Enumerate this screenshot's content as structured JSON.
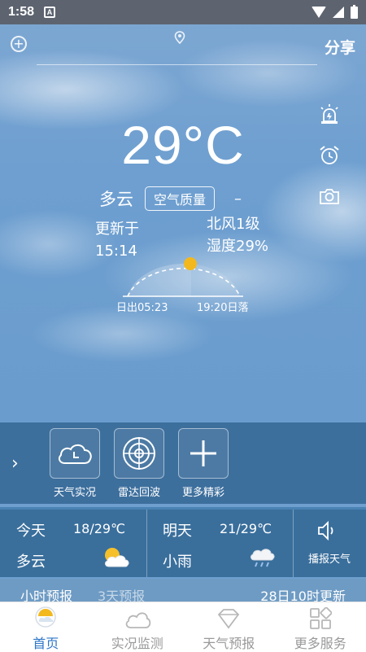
{
  "status_bar": {
    "time": "1:58",
    "badge": "A"
  },
  "header": {
    "share_label": "分享"
  },
  "current": {
    "temperature": "29°C",
    "condition": "多云",
    "aqi_label": "空气质量",
    "aqi_value": "–",
    "update_label": "更新于",
    "update_time": "15:14",
    "wind": "北风1级",
    "humidity": "湿度29%",
    "sunrise": "日出05:23",
    "sunset": "19:20日落"
  },
  "tools": [
    {
      "label": "天气实况",
      "icon": "cloud-clock-icon"
    },
    {
      "label": "雷达回波",
      "icon": "radar-icon"
    },
    {
      "label": "更多精彩",
      "icon": "plus-icon"
    }
  ],
  "forecast": {
    "today": {
      "day": "今天",
      "temps": "18/29℃",
      "desc": "多云",
      "icon": "partly-cloudy-icon"
    },
    "tomorrow": {
      "day": "明天",
      "temps": "21/29℃",
      "desc": "小雨",
      "icon": "light-rain-icon"
    },
    "broadcast_label": "播报天气"
  },
  "hourly_bar": {
    "tab_hourly": "小时预报",
    "tab_3day": "3天预报",
    "updated": "28日10时更新"
  },
  "bottom_nav": [
    {
      "label": "首页",
      "icon": "sun-home-icon",
      "active": true
    },
    {
      "label": "实况监测",
      "icon": "cloud-icon",
      "active": false
    },
    {
      "label": "天气预报",
      "icon": "diamond-icon",
      "active": false
    },
    {
      "label": "更多服务",
      "icon": "grid-icon",
      "active": false
    }
  ],
  "colors": {
    "accent": "#2d76c8",
    "sun": "#f2b81e"
  }
}
